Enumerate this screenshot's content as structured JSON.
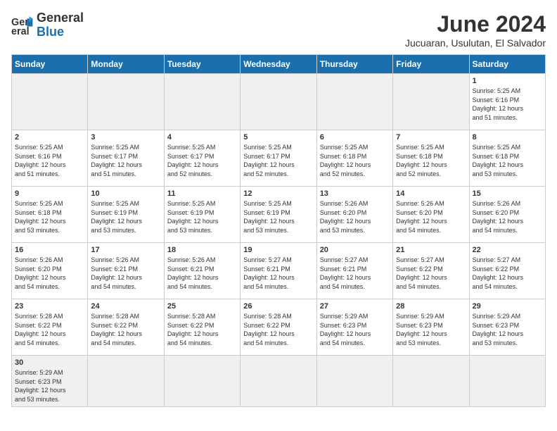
{
  "logo": {
    "text_general": "General",
    "text_blue": "Blue"
  },
  "title": "June 2024",
  "subtitle": "Jucuaran, Usulutan, El Salvador",
  "weekdays": [
    "Sunday",
    "Monday",
    "Tuesday",
    "Wednesday",
    "Thursday",
    "Friday",
    "Saturday"
  ],
  "weeks": [
    [
      {
        "day": "",
        "info": "",
        "empty": true
      },
      {
        "day": "",
        "info": "",
        "empty": true
      },
      {
        "day": "",
        "info": "",
        "empty": true
      },
      {
        "day": "",
        "info": "",
        "empty": true
      },
      {
        "day": "",
        "info": "",
        "empty": true
      },
      {
        "day": "",
        "info": "",
        "empty": true
      },
      {
        "day": "1",
        "info": "Sunrise: 5:25 AM\nSunset: 6:16 PM\nDaylight: 12 hours\nand 51 minutes."
      }
    ],
    [
      {
        "day": "2",
        "info": "Sunrise: 5:25 AM\nSunset: 6:16 PM\nDaylight: 12 hours\nand 51 minutes."
      },
      {
        "day": "3",
        "info": "Sunrise: 5:25 AM\nSunset: 6:17 PM\nDaylight: 12 hours\nand 51 minutes."
      },
      {
        "day": "4",
        "info": "Sunrise: 5:25 AM\nSunset: 6:17 PM\nDaylight: 12 hours\nand 52 minutes."
      },
      {
        "day": "5",
        "info": "Sunrise: 5:25 AM\nSunset: 6:17 PM\nDaylight: 12 hours\nand 52 minutes."
      },
      {
        "day": "6",
        "info": "Sunrise: 5:25 AM\nSunset: 6:18 PM\nDaylight: 12 hours\nand 52 minutes."
      },
      {
        "day": "7",
        "info": "Sunrise: 5:25 AM\nSunset: 6:18 PM\nDaylight: 12 hours\nand 52 minutes."
      },
      {
        "day": "8",
        "info": "Sunrise: 5:25 AM\nSunset: 6:18 PM\nDaylight: 12 hours\nand 53 minutes."
      }
    ],
    [
      {
        "day": "9",
        "info": "Sunrise: 5:25 AM\nSunset: 6:18 PM\nDaylight: 12 hours\nand 53 minutes."
      },
      {
        "day": "10",
        "info": "Sunrise: 5:25 AM\nSunset: 6:19 PM\nDaylight: 12 hours\nand 53 minutes."
      },
      {
        "day": "11",
        "info": "Sunrise: 5:25 AM\nSunset: 6:19 PM\nDaylight: 12 hours\nand 53 minutes."
      },
      {
        "day": "12",
        "info": "Sunrise: 5:25 AM\nSunset: 6:19 PM\nDaylight: 12 hours\nand 53 minutes."
      },
      {
        "day": "13",
        "info": "Sunrise: 5:26 AM\nSunset: 6:20 PM\nDaylight: 12 hours\nand 53 minutes."
      },
      {
        "day": "14",
        "info": "Sunrise: 5:26 AM\nSunset: 6:20 PM\nDaylight: 12 hours\nand 54 minutes."
      },
      {
        "day": "15",
        "info": "Sunrise: 5:26 AM\nSunset: 6:20 PM\nDaylight: 12 hours\nand 54 minutes."
      }
    ],
    [
      {
        "day": "16",
        "info": "Sunrise: 5:26 AM\nSunset: 6:20 PM\nDaylight: 12 hours\nand 54 minutes."
      },
      {
        "day": "17",
        "info": "Sunrise: 5:26 AM\nSunset: 6:21 PM\nDaylight: 12 hours\nand 54 minutes."
      },
      {
        "day": "18",
        "info": "Sunrise: 5:26 AM\nSunset: 6:21 PM\nDaylight: 12 hours\nand 54 minutes."
      },
      {
        "day": "19",
        "info": "Sunrise: 5:27 AM\nSunset: 6:21 PM\nDaylight: 12 hours\nand 54 minutes."
      },
      {
        "day": "20",
        "info": "Sunrise: 5:27 AM\nSunset: 6:21 PM\nDaylight: 12 hours\nand 54 minutes."
      },
      {
        "day": "21",
        "info": "Sunrise: 5:27 AM\nSunset: 6:22 PM\nDaylight: 12 hours\nand 54 minutes."
      },
      {
        "day": "22",
        "info": "Sunrise: 5:27 AM\nSunset: 6:22 PM\nDaylight: 12 hours\nand 54 minutes."
      }
    ],
    [
      {
        "day": "23",
        "info": "Sunrise: 5:28 AM\nSunset: 6:22 PM\nDaylight: 12 hours\nand 54 minutes."
      },
      {
        "day": "24",
        "info": "Sunrise: 5:28 AM\nSunset: 6:22 PM\nDaylight: 12 hours\nand 54 minutes."
      },
      {
        "day": "25",
        "info": "Sunrise: 5:28 AM\nSunset: 6:22 PM\nDaylight: 12 hours\nand 54 minutes."
      },
      {
        "day": "26",
        "info": "Sunrise: 5:28 AM\nSunset: 6:22 PM\nDaylight: 12 hours\nand 54 minutes."
      },
      {
        "day": "27",
        "info": "Sunrise: 5:29 AM\nSunset: 6:23 PM\nDaylight: 12 hours\nand 54 minutes."
      },
      {
        "day": "28",
        "info": "Sunrise: 5:29 AM\nSunset: 6:23 PM\nDaylight: 12 hours\nand 53 minutes."
      },
      {
        "day": "29",
        "info": "Sunrise: 5:29 AM\nSunset: 6:23 PM\nDaylight: 12 hours\nand 53 minutes."
      }
    ],
    [
      {
        "day": "30",
        "info": "Sunrise: 5:29 AM\nSunset: 6:23 PM\nDaylight: 12 hours\nand 53 minutes.",
        "last": true
      },
      {
        "day": "",
        "info": "",
        "empty": true,
        "last": true
      },
      {
        "day": "",
        "info": "",
        "empty": true,
        "last": true
      },
      {
        "day": "",
        "info": "",
        "empty": true,
        "last": true
      },
      {
        "day": "",
        "info": "",
        "empty": true,
        "last": true
      },
      {
        "day": "",
        "info": "",
        "empty": true,
        "last": true
      },
      {
        "day": "",
        "info": "",
        "empty": true,
        "last": true
      }
    ]
  ]
}
